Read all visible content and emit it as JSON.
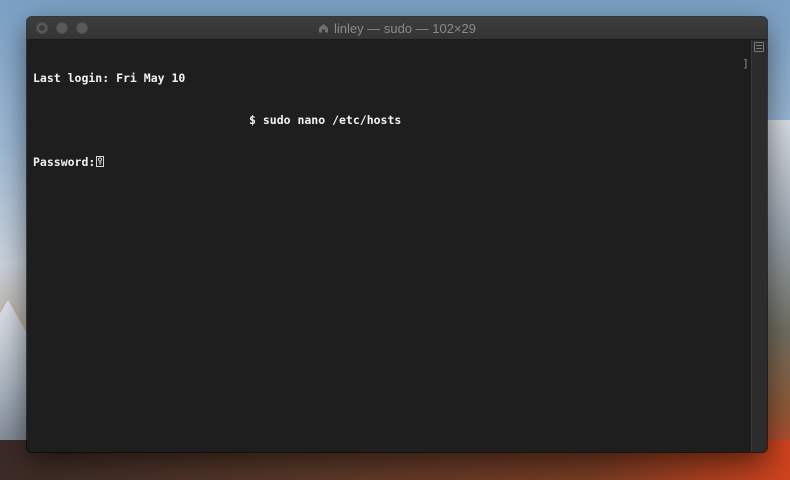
{
  "window": {
    "title": "linley — sudo — 102×29"
  },
  "terminal": {
    "lines": [
      "Last login: Fri May 10",
      "$ sudo nano /etc/hosts",
      "Password:"
    ],
    "right_marker": "]"
  },
  "colors": {
    "terminal_bg": "#1e1e1e",
    "terminal_fg": "#f2f2f2",
    "titlebar": "#3a3a3a",
    "title_text": "#8a8a8a"
  },
  "icons": {
    "title_icon": "home-icon",
    "cursor": "key-icon",
    "scroll": "scroll-button-icon"
  }
}
